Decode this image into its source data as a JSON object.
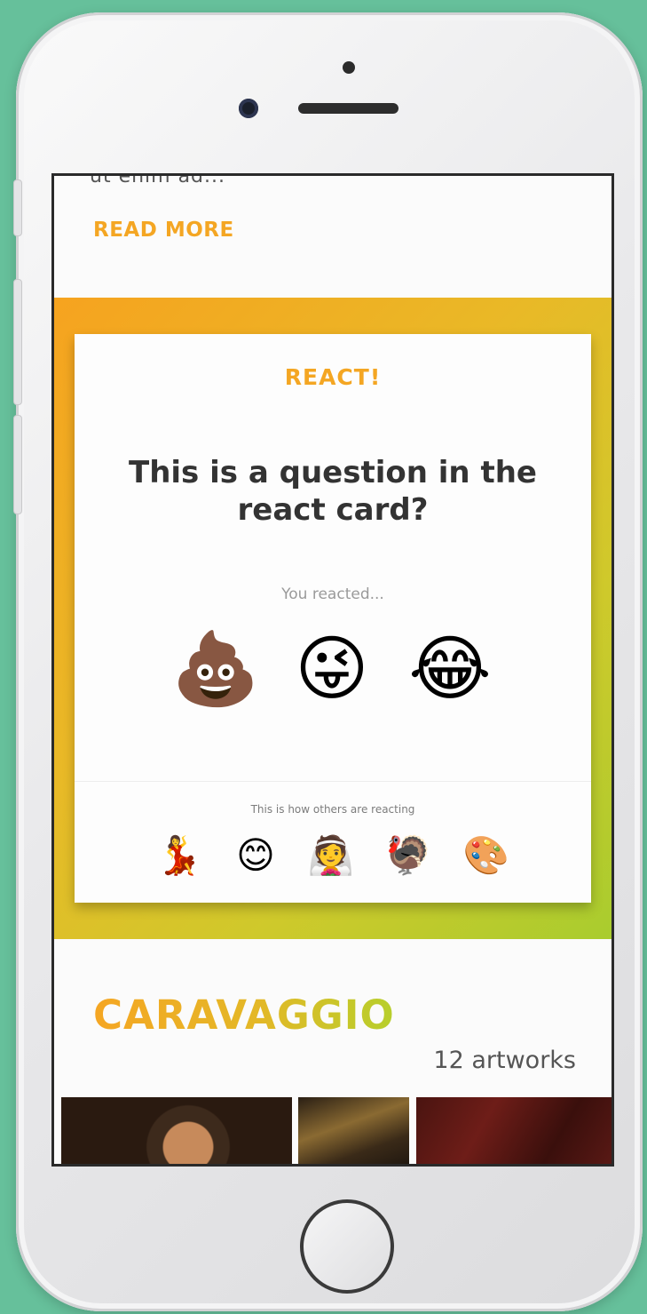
{
  "previous_article": {
    "snippet": "ut enim ad...",
    "read_more_label": "READ MORE"
  },
  "react_card": {
    "title": "REACT!",
    "question": "This is a question in the react card?",
    "you_reacted_label": "You reacted...",
    "your_reactions": [
      {
        "icon": "pile-of-poo-icon",
        "glyph": "💩"
      },
      {
        "icon": "winking-tongue-face-icon",
        "glyph": "😜"
      },
      {
        "icon": "tears-of-joy-face-icon",
        "glyph": "😂"
      }
    ],
    "others_label": "This is how others are reacting",
    "others_reactions": [
      {
        "icon": "dancer-icon",
        "glyph": "💃"
      },
      {
        "icon": "smiling-face-icon",
        "glyph": "😊"
      },
      {
        "icon": "bride-icon",
        "glyph": "👰"
      },
      {
        "icon": "turkey-icon",
        "glyph": "🦃"
      },
      {
        "icon": "artist-palette-icon",
        "glyph": "🎨"
      }
    ]
  },
  "artist_section": {
    "name": "CARAVAGGIO",
    "artwork_count": "12 artworks"
  },
  "colors": {
    "accent_orange": "#f4a623",
    "accent_green": "#a9cc2e",
    "background": "#66c09b"
  }
}
